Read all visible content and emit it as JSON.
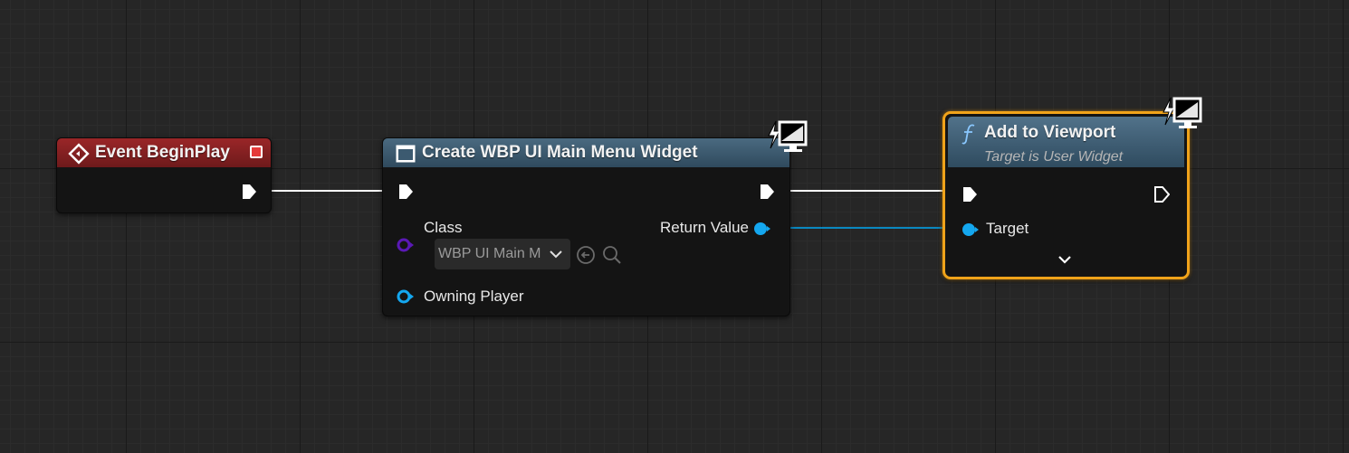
{
  "nodes": {
    "event_begin_play": {
      "title": "Event BeginPlay",
      "header_color": "#7e1d1e"
    },
    "create_widget": {
      "title": "Create WBP UI Main Menu Widget",
      "header_color": "#3c5a70",
      "pins": {
        "class_label": "Class",
        "class_value": "WBP UI Main Menu",
        "owning_player_label": "Owning Player",
        "return_value_label": "Return Value"
      }
    },
    "add_to_viewport": {
      "title": "Add to Viewport",
      "subtitle": "Target is User Widget",
      "header_color": "#3f5e73",
      "selected_outline_color": "#f0a31a",
      "pins": {
        "target_label": "Target"
      }
    }
  },
  "colors": {
    "exec_wire": "#ffffff",
    "object_wire": "#00a8f3",
    "class_pin": "#5a19b5",
    "object_pin": "#14a7ef"
  },
  "icons": {
    "event_node_icon": "event-diamond-icon",
    "widget_node_icon": "widget-icon",
    "function_icon": "function-f-icon",
    "network_icon": "lightning-monitor-icon",
    "expand_icon": "chevron-down-icon"
  }
}
